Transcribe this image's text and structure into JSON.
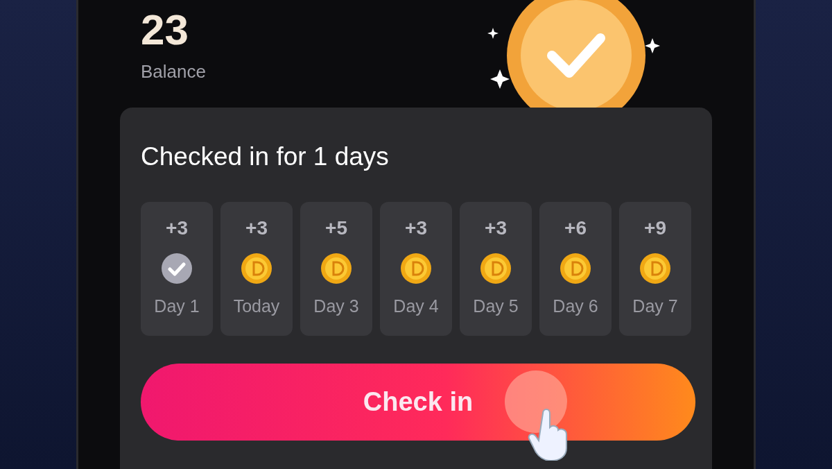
{
  "balance": {
    "value": "23",
    "label": "Balance"
  },
  "checkin": {
    "title": "Checked in for 1 days",
    "days": [
      {
        "reward": "+3",
        "label": "Day 1",
        "checked": true
      },
      {
        "reward": "+3",
        "label": "Today",
        "checked": false
      },
      {
        "reward": "+5",
        "label": "Day 3",
        "checked": false
      },
      {
        "reward": "+3",
        "label": "Day 4",
        "checked": false
      },
      {
        "reward": "+3",
        "label": "Day 5",
        "checked": false
      },
      {
        "reward": "+6",
        "label": "Day 6",
        "checked": false
      },
      {
        "reward": "+9",
        "label": "Day 7",
        "checked": false
      }
    ],
    "button": "Check in"
  }
}
